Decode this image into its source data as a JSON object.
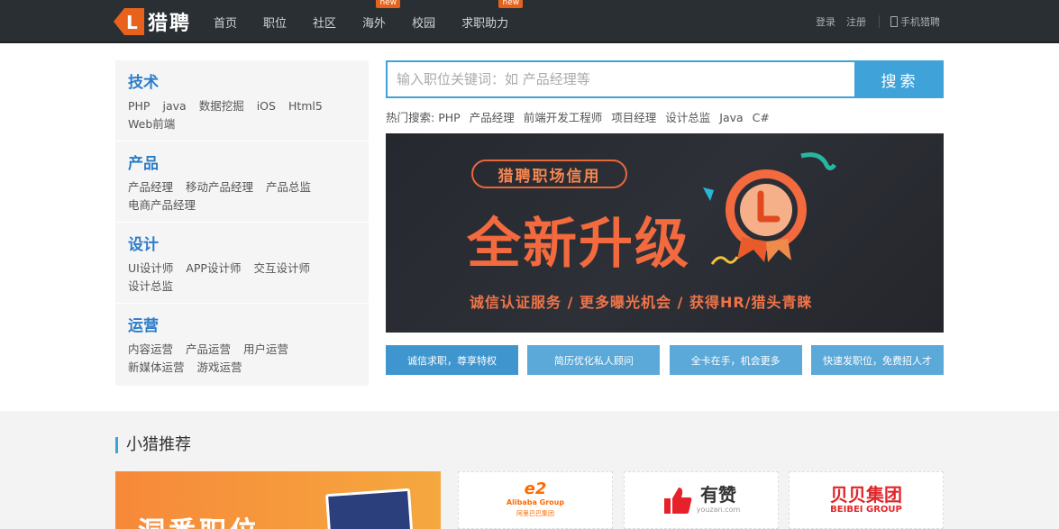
{
  "header": {
    "logo_text": "猎聘",
    "nav": [
      {
        "label": "首页",
        "badge": ""
      },
      {
        "label": "职位",
        "badge": ""
      },
      {
        "label": "社区",
        "badge": ""
      },
      {
        "label": "海外",
        "badge": "new"
      },
      {
        "label": "校园",
        "badge": ""
      },
      {
        "label": "求职助力",
        "badge": "new"
      }
    ],
    "login": "登录",
    "register": "注册",
    "mobile": "手机猎聘"
  },
  "categories": [
    {
      "title": "技术",
      "links": [
        "PHP",
        "java",
        "数据挖掘",
        "iOS",
        "Html5",
        "Web前端"
      ]
    },
    {
      "title": "产品",
      "links": [
        "产品经理",
        "移动产品经理",
        "产品总监",
        "电商产品经理"
      ]
    },
    {
      "title": "设计",
      "links": [
        "UI设计师",
        "APP设计师",
        "交互设计师",
        "设计总监"
      ]
    },
    {
      "title": "运营",
      "links": [
        "内容运营",
        "产品运营",
        "用户运营",
        "新媒体运营",
        "游戏运营"
      ]
    }
  ],
  "search": {
    "placeholder": "输入职位关键词：如 产品经理等",
    "button": "搜索",
    "hot_label": "热门搜索:",
    "hot": [
      "PHP",
      "产品经理",
      "前端开发工程师",
      "项目经理",
      "设计总监",
      "Java",
      "C#"
    ]
  },
  "banner": {
    "pill": "猎聘职场信用",
    "headline": "全新升级",
    "subline": "诚信认证服务  /  更多曝光机会  /  获得HR/猎头青睐"
  },
  "tiles": [
    "诚信求职，尊享特权",
    "简历优化私人顾问",
    "全卡在手，机会更多",
    "快速发职位，免费招人才"
  ],
  "recommend": {
    "title": "小猎推荐",
    "banner_text": "洞悉职位",
    "companies": [
      {
        "name": "Alibaba Group",
        "sub": "阿里巴巴集团",
        "color": "#ff6a00"
      },
      {
        "name": "有赞",
        "sub": "youzan.com",
        "color": "#e62129"
      },
      {
        "name": "贝贝集团",
        "sub": "BEIBEI GROUP",
        "color": "#e0262a"
      }
    ]
  },
  "colors": {
    "accent": "#3fa2d8",
    "topbar": "#2a2f34",
    "brand_orange": "#f26a3d"
  }
}
